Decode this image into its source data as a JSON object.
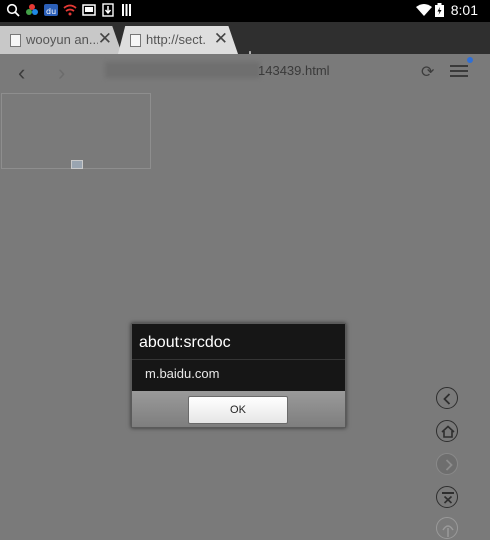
{
  "status_bar": {
    "time": "8:01",
    "notification_icons": [
      "search-icon",
      "app-icon",
      "baidu-icon",
      "wifi-notify-icon",
      "gallery-icon",
      "download-icon",
      "sim-icon"
    ],
    "right_icons": [
      "wifi-icon",
      "battery-icon"
    ]
  },
  "tabs": [
    {
      "label": "wooyun an...",
      "active": false
    },
    {
      "label": "http://sect.",
      "active": true
    }
  ],
  "address_bar": {
    "url_visible": "143439.html"
  },
  "dialog": {
    "title": "about:srcdoc",
    "message": "m.baidu.com",
    "ok_label": "OK"
  },
  "side_buttons": [
    "back-circle-icon",
    "home-icon",
    "forward-circle-icon",
    "close-tabs-icon",
    "upload-icon"
  ]
}
